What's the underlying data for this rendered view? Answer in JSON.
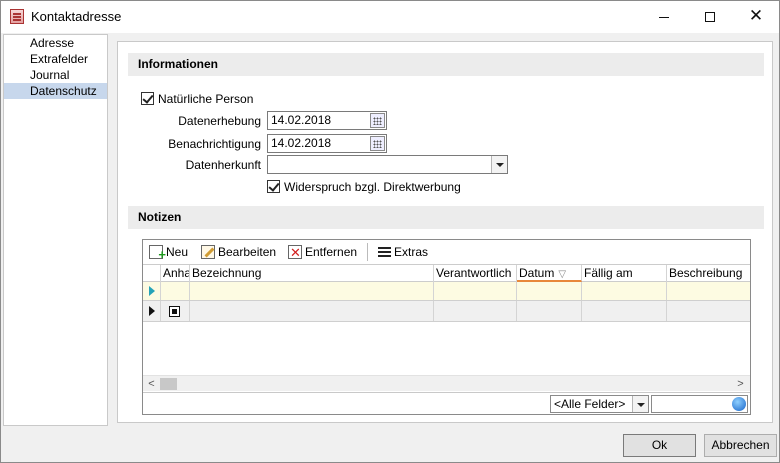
{
  "window": {
    "title": "Kontaktadresse"
  },
  "sidebar": {
    "items": [
      {
        "label": "Adresse",
        "active": false
      },
      {
        "label": "Extrafelder",
        "active": false
      },
      {
        "label": "Journal",
        "active": false
      },
      {
        "label": "Datenschutz",
        "active": true
      }
    ]
  },
  "informationen": {
    "title": "Informationen",
    "natuerliche_person": {
      "label": "Natürliche Person",
      "checked": true
    },
    "datenerhebung": {
      "label": "Datenerhebung",
      "value": "14.02.2018"
    },
    "benachrichtigung": {
      "label": "Benachrichtigung",
      "value": "14.02.2018"
    },
    "datenherkunft": {
      "label": "Datenherkunft",
      "value": ""
    },
    "widerspruch": {
      "label": "Widerspruch bzgl. Direktwerbung",
      "checked": true
    }
  },
  "notizen": {
    "title": "Notizen",
    "toolbar": {
      "neu": "Neu",
      "bearbeiten": "Bearbeiten",
      "entfernen": "Entfernen",
      "extras": "Extras"
    },
    "columns": [
      "Anha",
      "Bezeichnung",
      "Verantwortlich",
      "Datum",
      "Fällig am",
      "Beschreibung"
    ],
    "sorted_column": "Datum",
    "fields_selector": "<Alle Felder>"
  },
  "buttons": {
    "ok": "Ok",
    "cancel": "Abbrechen"
  },
  "colors": {
    "selected_nav": "#c7d7ec",
    "new_row": "#fdfbe2",
    "sort_accent": "#e8873a"
  }
}
